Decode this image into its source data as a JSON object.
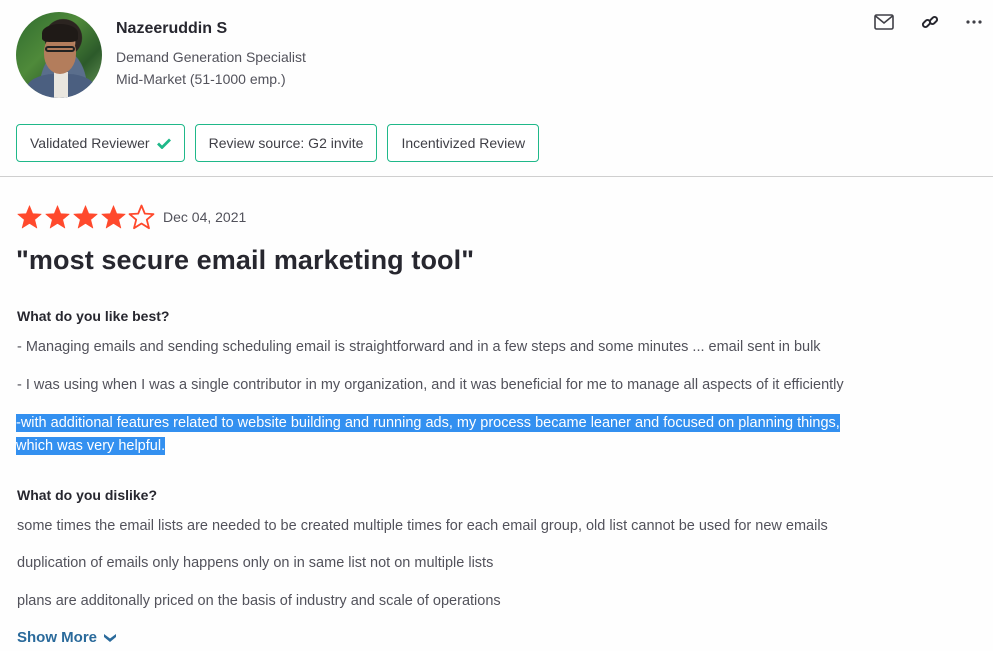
{
  "reviewer": {
    "name": "Nazeeruddin S",
    "job_title": "Demand Generation Specialist",
    "segment": "Mid-Market (51-1000 emp.)",
    "avatar_icon": "user-avatar-photo"
  },
  "actions": {
    "email_icon": "mail-icon",
    "link_icon": "link-icon",
    "more_icon": "more-icon"
  },
  "badges": [
    {
      "label": "Validated Reviewer",
      "icon": "check-icon"
    },
    {
      "label": "Review source: G2 invite"
    },
    {
      "label": "Incentivized Review"
    }
  ],
  "review": {
    "rating": 4,
    "max_rating": 5,
    "date": "Dec 04, 2021",
    "title": "\"most secure email marketing tool\"",
    "like_question": "What do you like best?",
    "like_answers": [
      "- Managing emails and sending scheduling email is straightforward and in a few steps and some minutes ... email sent in bulk",
      "- I was using when I was a single contributor in my organization, and it was beneficial for me to manage all aspects of it efficiently"
    ],
    "like_highlighted_lines": [
      "-with additional features related to website building and running ads, my process became leaner and focused on planning things,",
      "which was very helpful."
    ],
    "dislike_question": "What do you dislike?",
    "dislike_answers": [
      "some times the email lists are needed to be created multiple times for each email group, old list cannot be used for new emails",
      "duplication of emails only happens only on in same list not on multiple lists",
      "plans are additonally priced on the basis of industry and scale of operations"
    ],
    "show_more_label": "Show More"
  },
  "colors": {
    "star": "#ff492c",
    "badge_border": "#1fb889",
    "highlight": "#3390f0",
    "link": "#2a6a9b"
  }
}
